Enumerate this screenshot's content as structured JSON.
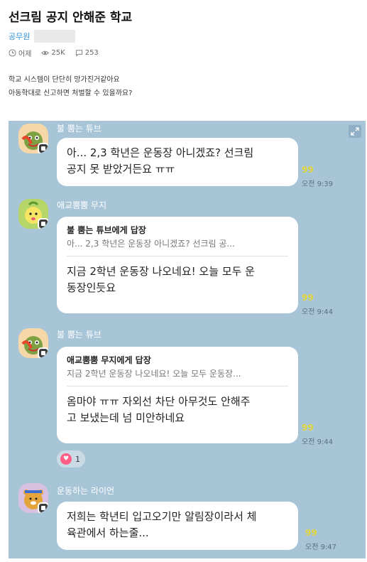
{
  "post": {
    "title": "선크림 공지 안해준 학교",
    "author": "공무원",
    "time": "어제",
    "views": "25K",
    "comments": "253",
    "body_lines": [
      "학교 시스템이 단단히 망가진거같아요",
      "아동학대로 신고하면 처벌할 수 있을까요?"
    ]
  },
  "chat": {
    "messages": [
      {
        "sender": "불 뿜는 튜브",
        "avatar_icon": "tube-avatar-icon",
        "lines": [
          "아... 2,3 학년은 운동장 아니겠죠? 선크림",
          "공지 못 받았거든요 ㅠㅠ"
        ],
        "read": "99",
        "time": "오전 9:39"
      },
      {
        "sender": "애교뿜뿜 무지",
        "avatar_icon": "muzi-avatar-icon",
        "reply_to": "불 뿜는 튜브에게 답장",
        "quote": "아... 2,3 학년은 운동장 아니겠죠? 선크림 공...",
        "lines": [
          "지금 2학년 운동장 나오네요! 오늘 모두 운",
          "동장인듯요"
        ],
        "read": "99",
        "time": "오전 9:44"
      },
      {
        "sender": "불 뿜는 튜브",
        "avatar_icon": "tube-avatar-icon",
        "reply_to": "애교뿜뿜 무지에게 답장",
        "quote": "지금 2학년 운동장 나오네요! 오늘 모두 운동장...",
        "lines": [
          "옴마야 ㅠㅠ 자외선 차단 아무것도 안해주",
          "고 보냈는데 넘 미안하네요"
        ],
        "read": "99",
        "time": "오전 9:44",
        "reaction": "1"
      },
      {
        "sender": "운동하는 라이언",
        "avatar_icon": "ryan-avatar-icon",
        "lines": [
          "저희는 학년티 입고오기만 알림장이라서 체",
          "육관에서 하는줄..."
        ],
        "read": "99",
        "time": "오전 9:47"
      }
    ]
  }
}
